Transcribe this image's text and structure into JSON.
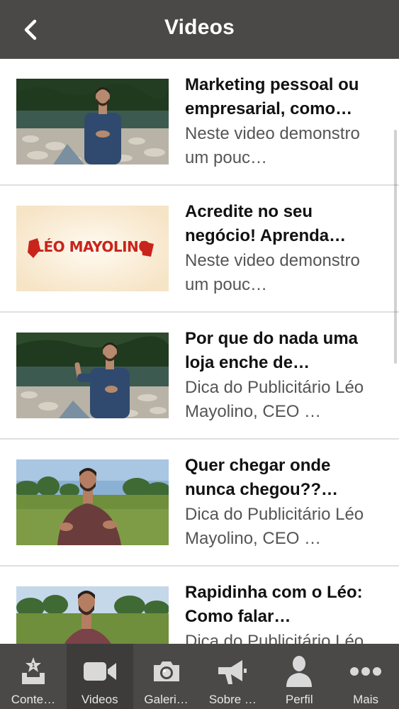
{
  "header": {
    "title": "Videos",
    "back_icon": "chevron-left-icon"
  },
  "videos": [
    {
      "title": "Marketing pessoal ou empresarial, como…",
      "description": "Neste video demonstro um pouc…",
      "thumbnail": "man-by-river-thumbnail"
    },
    {
      "title": "Acredite no seu negócio! Aprenda…",
      "description": "Neste video demonstro um pouc…",
      "thumbnail": "logo-thumbnail",
      "logo_text": "LÉO MAYOLINO"
    },
    {
      "title": "Por que do nada uma loja enche de…",
      "description": "Dica do Publicitário Léo Mayolino, CEO …",
      "thumbnail": "man-by-river-thumbnail"
    },
    {
      "title": "Quer chegar onde nunca chegou??…",
      "description": "Dica do Publicitário Léo Mayolino, CEO …",
      "thumbnail": "man-in-field-thumbnail"
    },
    {
      "title": "Rapidinha com o Léo: Como falar…",
      "description": "Dica do Publicitário Léo Mayolino, CEO …",
      "thumbnail": "man-in-field-thumbnail"
    }
  ],
  "tabbar": {
    "tabs": [
      {
        "label": "Conte…",
        "icon": "content-icon",
        "active": false
      },
      {
        "label": "Videos",
        "icon": "video-camera-icon",
        "active": true
      },
      {
        "label": "Galeri…",
        "icon": "camera-icon",
        "active": false
      },
      {
        "label": "Sobre …",
        "icon": "megaphone-icon",
        "active": false
      },
      {
        "label": "Perfil",
        "icon": "person-icon",
        "active": false
      },
      {
        "label": "Mais",
        "icon": "more-dots-icon",
        "active": false
      }
    ]
  },
  "colors": {
    "bar_background": "#4a4948",
    "active_tab": "#3d3c3b",
    "title_text": "#111111",
    "description_text": "#555555",
    "logo_red": "#c9241c"
  }
}
